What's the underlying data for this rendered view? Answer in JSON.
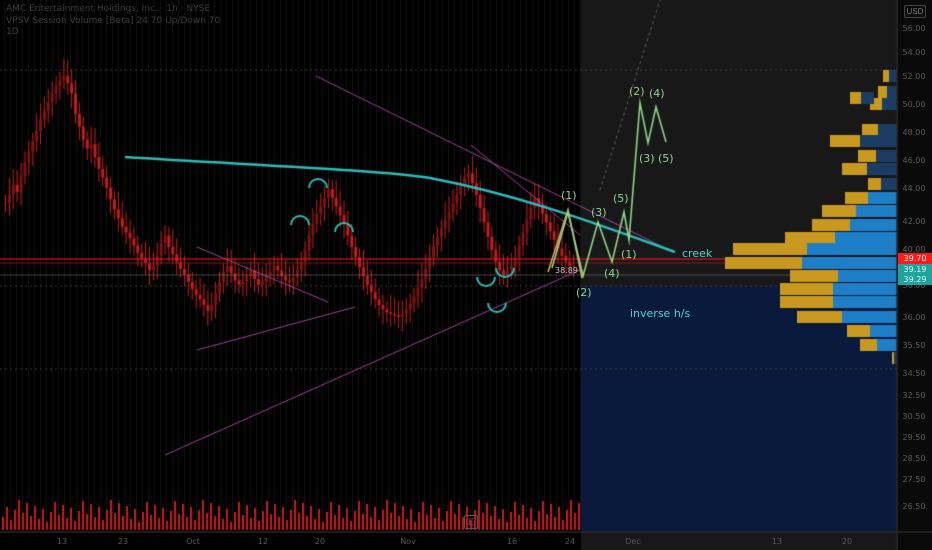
{
  "header": {
    "title": "AMC Entertainment Holdings, Inc. · 1h · NYSE",
    "indicator": "VPSV Session Volume [Beta] 24 70 Up/Down 70",
    "extra": "1D"
  },
  "currency": "USD",
  "colors": {
    "candle": "#c01e1e",
    "volume": "#c01e1e",
    "future_bg": "#181818",
    "ray_box": "#0a1a3c",
    "trendline": "#c04fbe",
    "smoothed": "#2bbcbc",
    "wave": "#8fd28a",
    "wave_orange": "#d6a64b",
    "price_line": "#ff1a1a",
    "vp_gold": "#c9981e",
    "vp_blue": "#1f7ec8",
    "vp_navy": "#1c3d63",
    "vp_brown": "#5a4a22"
  },
  "chart_data": {
    "type": "candlestick",
    "y_axis_ticks": [
      "56.00",
      "54.00",
      "52.00",
      "50.00",
      "48.00",
      "46.00",
      "44.00",
      "42.00",
      "40.00",
      "38.00",
      "36.00",
      "35.50",
      "34.50",
      "32.50",
      "30.50",
      "29.50",
      "28.50",
      "27.50",
      "26.50"
    ],
    "x_axis_ticks": [
      "13",
      "23",
      "Oct",
      "12",
      "20",
      "Nov",
      "16",
      "24",
      "Dec",
      "13",
      "20"
    ],
    "last_price": "39.70",
    "price_badges": [
      "39.19",
      "39.29"
    ],
    "wave_labels": [
      "(1)",
      "(2)",
      "(3)",
      "(4)",
      "(5)",
      "(2)",
      "(4)",
      "(1)",
      "(3)",
      "(5)"
    ],
    "annotations": {
      "creek": "creek",
      "inverse": "inverse h/s",
      "support_label": "38.89"
    },
    "closes": [
      43.2,
      43.8,
      44.5,
      44.0,
      45.1,
      46.0,
      46.8,
      47.5,
      48.2,
      49.0,
      49.6,
      50.2,
      50.8,
      51.3,
      51.7,
      52.0,
      51.5,
      50.8,
      49.4,
      48.5,
      47.6,
      47.0,
      47.3,
      46.4,
      45.6,
      45.0,
      44.3,
      43.5,
      42.8,
      42.2,
      41.6,
      41.2,
      40.8,
      40.3,
      39.8,
      39.4,
      39.1,
      38.6,
      38.9,
      39.6,
      40.5,
      41.0,
      40.2,
      39.7,
      39.2,
      38.7,
      38.3,
      37.8,
      37.3,
      36.9,
      36.6,
      36.2,
      35.8,
      36.2,
      37.0,
      37.8,
      38.5,
      38.9,
      38.4,
      37.9,
      37.6,
      37.8,
      38.2,
      38.6,
      38.0,
      37.6,
      37.8,
      38.2,
      38.5,
      38.9,
      38.6,
      38.2,
      37.9,
      37.8,
      38.1,
      38.6,
      39.2,
      40.0,
      41.0,
      41.8,
      42.5,
      43.0,
      43.6,
      44.2,
      43.6,
      43.0,
      42.4,
      41.8,
      41.0,
      40.2,
      39.5,
      38.8,
      38.2,
      37.6,
      37.1,
      36.6,
      36.2,
      35.9,
      35.7,
      35.6,
      35.5,
      35.4,
      35.6,
      35.9,
      36.3,
      36.8,
      37.4,
      38.0,
      38.7,
      39.5,
      40.3,
      40.9,
      41.5,
      42.1,
      42.6,
      43.2,
      43.8,
      44.4,
      45.0,
      45.3,
      44.6,
      43.8,
      42.9,
      41.9,
      40.9,
      40.0,
      39.2,
      38.6,
      38.3,
      38.6,
      38.9,
      39.5,
      40.3,
      41.2,
      42.1,
      42.9,
      43.6,
      43.1,
      42.5,
      41.9,
      41.3,
      40.7,
      40.1,
      39.6,
      39.2,
      38.9,
      39.0
    ]
  }
}
